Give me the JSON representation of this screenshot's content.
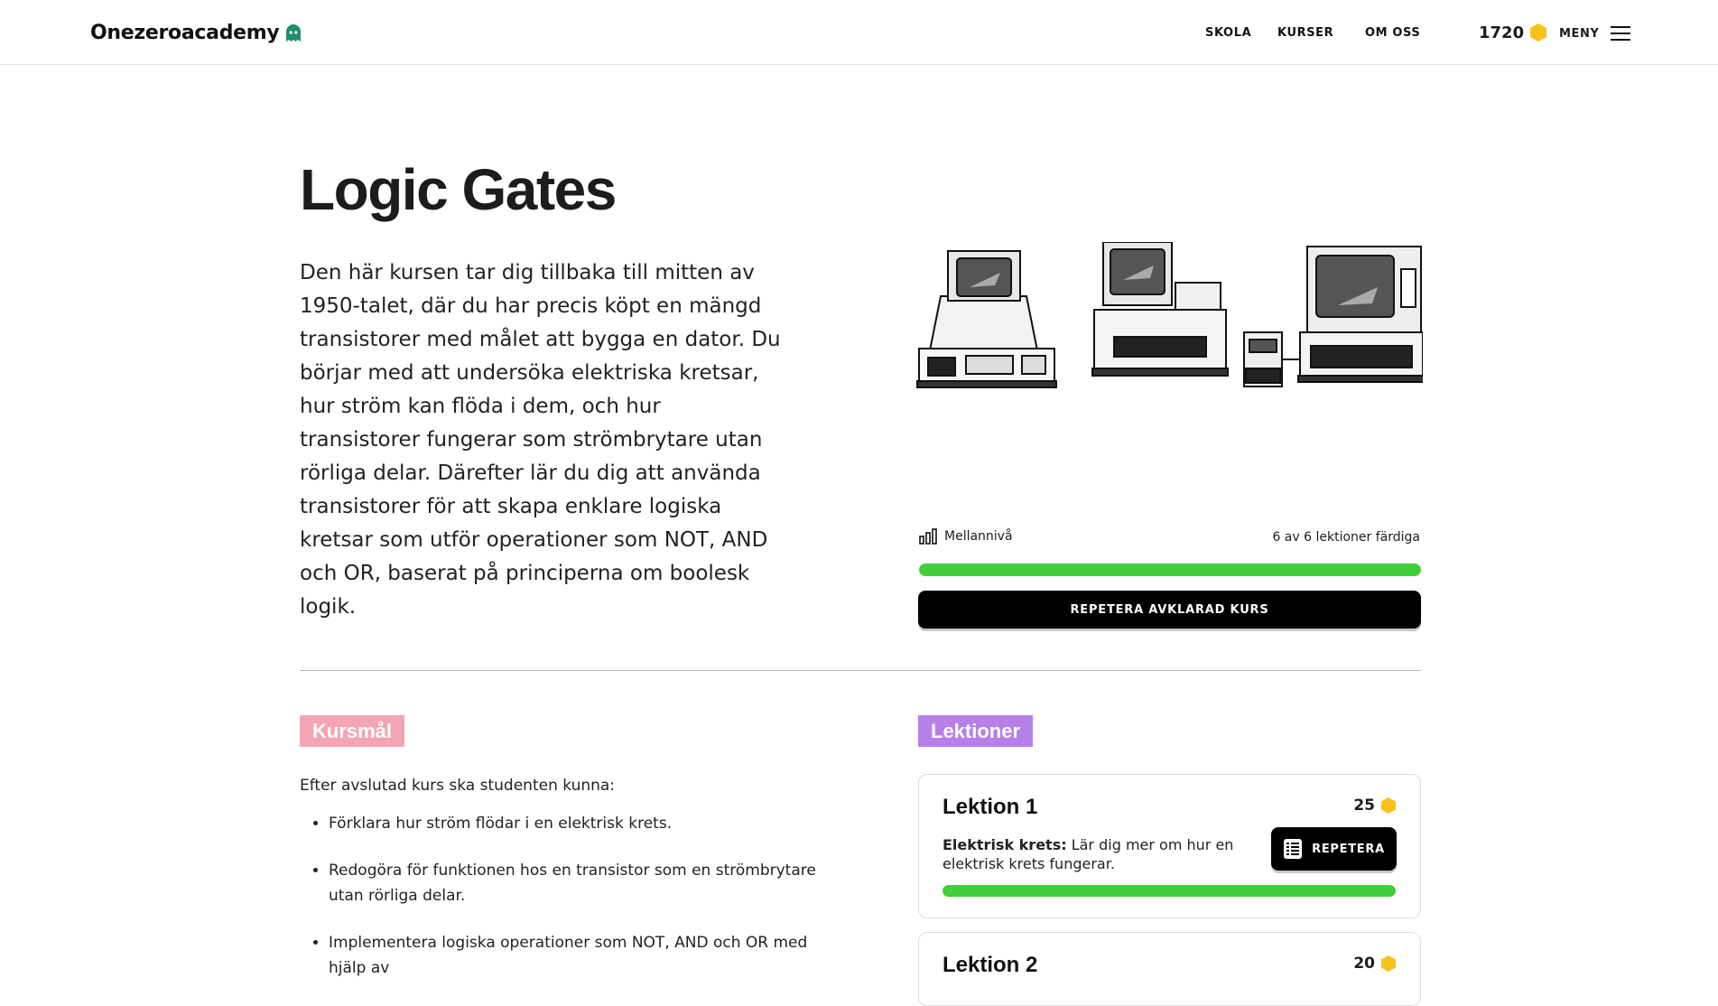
{
  "brand": {
    "name": "Onezeroacademy",
    "logo_icon": "ghost-icon"
  },
  "nav": {
    "items": [
      "SKOLA",
      "KURSER",
      "OM OSS"
    ]
  },
  "user": {
    "coins": "1720",
    "coin_icon": "hexagon-coin-icon"
  },
  "menu": {
    "label": "MENY",
    "icon": "hamburger-icon"
  },
  "course": {
    "title": "Logic Gates",
    "description": "Den här kursen tar dig tillbaka till mitten av 1950-talet, där du har precis köpt en mängd transistorer med målet att bygga en dator. Du börjar med att undersöka elektriska kretsar, hur ström kan flöda i dem, och hur transistorer fungerar som strömbrytare utan rörliga delar. Därefter lär du dig att använda transistorer för att skapa enklare logiska kretsar som utför operationer som NOT, AND och OR, baserat på principerna om boolesk logik.",
    "level": "Mellannivå",
    "level_icon": "bar-chart-icon",
    "progress_text": "6 av 6 lektioner färdiga",
    "progress": 1.0,
    "action_label": "REPETERA AVKLARAD KURS"
  },
  "goals": {
    "tag": "Kursmål",
    "intro": "Efter avslutad kurs ska studenten kunna:",
    "items": [
      "Förklara hur ström flödar i en elektrisk krets.",
      "Redogöra för funktionen hos en transistor som en strömbrytare utan rörliga delar.",
      "Implementera logiska operationer som NOT, AND och OR med hjälp av"
    ]
  },
  "lessons": {
    "tag": "Lektioner",
    "items": [
      {
        "title": "Lektion 1",
        "points": "25",
        "desc_bold": "Elektrisk krets:",
        "desc_rest": " Lär dig mer om hur en elektrisk krets fungerar.",
        "button_label": "REPETERA",
        "button_icon": "list-icon",
        "progress": 1.0
      },
      {
        "title": "Lektion 2",
        "points": "20"
      }
    ]
  },
  "colors": {
    "accent_green": "#3fcf3a",
    "goals_tag": "#f3a5b3",
    "lessons_tag": "#b680e8",
    "coin": "#f7c31a",
    "logo_ghost": "#1e8f6e"
  }
}
